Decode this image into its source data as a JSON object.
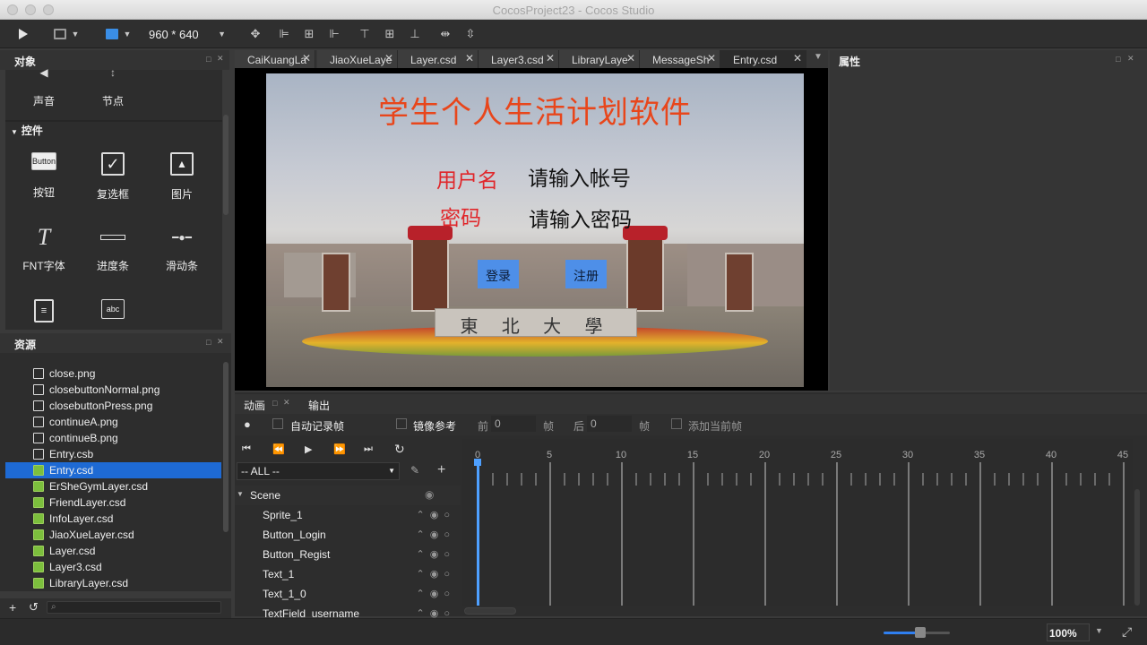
{
  "window": {
    "title": "CocosProject23 - Cocos Studio"
  },
  "toolbar": {
    "resolution": "960 * 640"
  },
  "objects_panel": {
    "title": "对象",
    "top_items": [
      "声音",
      "节点"
    ],
    "section": "控件",
    "controls": [
      "按钮",
      "复选框",
      "图片",
      "FNT字体",
      "进度条",
      "滑动条"
    ],
    "button_icon_text": "Button",
    "text_icon": "T",
    "textfield_icon_text": "abc"
  },
  "resources_panel": {
    "title": "资源",
    "files": [
      "close.png",
      "closebuttonNormal.png",
      "closebuttonPress.png",
      "continueA.png",
      "continueB.png",
      "Entry.csb",
      "Entry.csd",
      "ErSheGymLayer.csd",
      "FriendLayer.csd",
      "InfoLayer.csd",
      "JiaoXueLayer.csd",
      "Layer.csd",
      "Layer3.csd",
      "LibraryLayer.csd"
    ],
    "selected": "Entry.csd"
  },
  "tabs": [
    "CaiKuangLa",
    "JiaoXueLaye",
    "Layer.csd",
    "Layer3.csd",
    "LibraryLaye",
    "MessageSh",
    "Entry.csd"
  ],
  "active_tab": "Entry.csd",
  "properties_panel": {
    "title": "属性"
  },
  "canvas": {
    "title": "学生个人生活计划软件",
    "username_label": "用户名",
    "username_placeholder": "请输入帐号",
    "password_label": "密码",
    "password_placeholder": "请输入密码",
    "login_button": "登录",
    "register_button": "注册",
    "gate_text": "東 北 大 學"
  },
  "animation_panel": {
    "tab_animation": "动画",
    "tab_output": "输出",
    "auto_record": "自动记录帧",
    "mirror_ref": "镜像参考",
    "prev_label": "前",
    "prev_value": "0",
    "frame_unit": "帧",
    "next_label": "后",
    "next_value": "0",
    "add_current": "添加当前帧",
    "filter": "-- ALL --",
    "root": "Scene",
    "nodes": [
      "Sprite_1",
      "Button_Login",
      "Button_Regist",
      "Text_1",
      "Text_1_0",
      "TextField_username"
    ],
    "timeline_numbers": [
      "0",
      "5",
      "10",
      "15",
      "20",
      "25",
      "30",
      "35",
      "40",
      "45"
    ]
  },
  "statusbar": {
    "zoom": "100%"
  },
  "colors": {
    "accent": "#1f6fd6",
    "selected_row": "#1e6ad4",
    "title_text": "#e8461b",
    "label_text": "#e0262a",
    "button_bg": "#4e8fe8"
  }
}
